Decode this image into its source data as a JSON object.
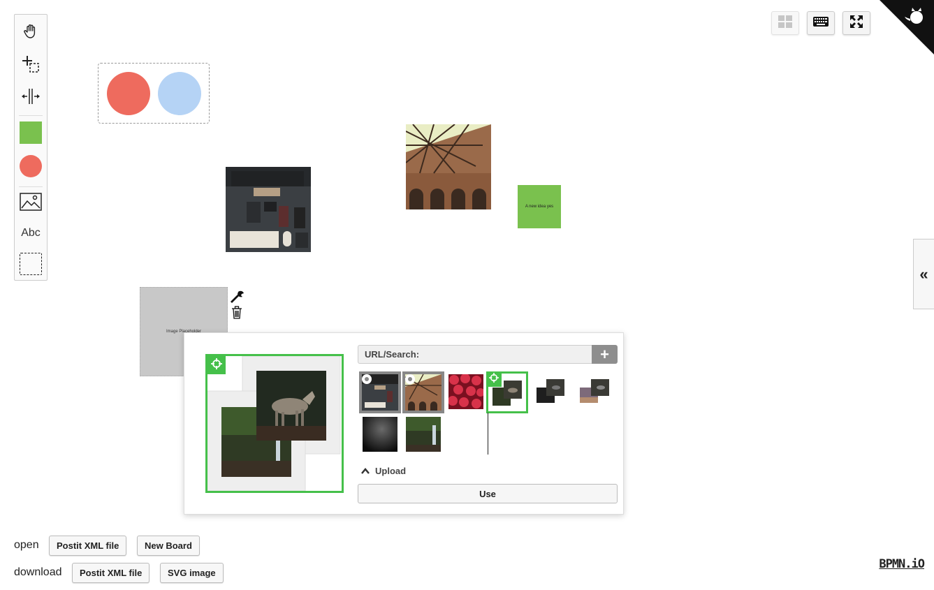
{
  "palette": {
    "tools": [
      {
        "name": "hand-tool",
        "icon": "hand-icon"
      },
      {
        "name": "lasso-tool",
        "icon": "lasso-icon"
      },
      {
        "name": "space-tool",
        "icon": "space-icon"
      },
      {
        "name": "create-sticky",
        "icon": "green-square-icon"
      },
      {
        "name": "create-circle",
        "icon": "red-circle-icon"
      },
      {
        "name": "create-image",
        "icon": "image-icon"
      },
      {
        "name": "create-text",
        "icon": "text-icon",
        "label": "Abc"
      },
      {
        "name": "create-group",
        "icon": "dashed-frame-icon"
      }
    ]
  },
  "toolbar": {
    "buttons": [
      {
        "name": "grid-button",
        "icon": "grid-icon",
        "disabled": true
      },
      {
        "name": "keyboard-button",
        "icon": "keyboard-icon"
      },
      {
        "name": "fullscreen-button",
        "icon": "fullscreen-icon"
      }
    ]
  },
  "canvas": {
    "colors": {
      "red": "#ee6b5e",
      "blue": "#b5d3f5",
      "green": "#7ac14e"
    },
    "sticky_text": "A new idea yes",
    "placeholder_text": "Image Placeholder"
  },
  "context_pad": {
    "icons": [
      "wrench-icon",
      "trash-icon"
    ]
  },
  "image_dialog": {
    "url_label": "URL/Search:",
    "add_symbol": "+",
    "upload_label": "Upload",
    "use_label": "Use",
    "thumbnails": [
      "desk",
      "bridge",
      "strawberries",
      "wolf-waterfall",
      "wolf-dark",
      "wolf-road",
      "dark",
      "waterfall"
    ],
    "selected_thumbnail": "wolf-waterfall"
  },
  "bottom": {
    "open_label": "open",
    "download_label": "download",
    "open_postit": "Postit XML file",
    "new_board": "New Board",
    "download_postit": "Postit XML file",
    "svg_image": "SVG image"
  },
  "logo": "BPMN.iO",
  "side_toggle": "«"
}
